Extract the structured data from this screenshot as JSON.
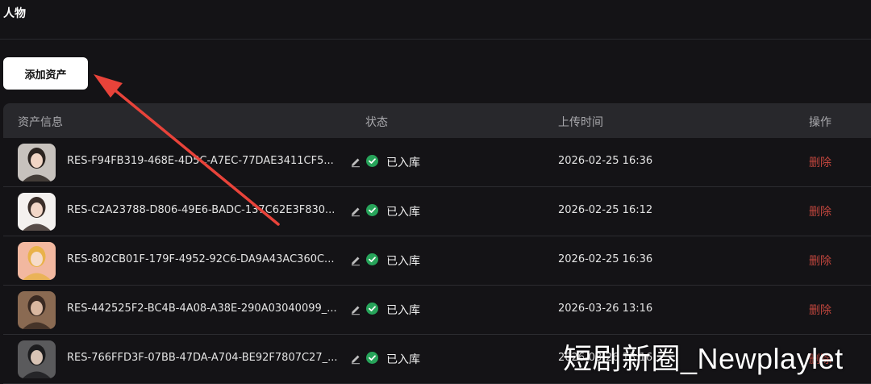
{
  "page": {
    "title": "人物",
    "add_button_label": "添加资产"
  },
  "table": {
    "headers": {
      "info": "资产信息",
      "status": "状态",
      "upload_time": "上传时间",
      "actions": "操作"
    },
    "rows": [
      {
        "id": "RES-F94FB319-468E-4D5C-A7EC-77DAE3411CF5...",
        "status": "已入库",
        "upload_time": "2026-02-25 16:36",
        "action": "删除",
        "thumb_colors": [
          "#c7c2bd",
          "#2b2420",
          "#f1d5c4"
        ]
      },
      {
        "id": "RES-C2A23788-D806-49E6-BADC-137C62E3F830...",
        "status": "已入库",
        "upload_time": "2026-02-25 16:12",
        "action": "删除",
        "thumb_colors": [
          "#f4f1ef",
          "#3b2f2a",
          "#f3d7c8"
        ]
      },
      {
        "id": "RES-802CB01F-179F-4952-92C6-DA9A43AC360C...",
        "status": "已入库",
        "upload_time": "2026-02-25 16:36",
        "action": "删除",
        "thumb_colors": [
          "#f2b8a0",
          "#e9b24a",
          "#f6dcc9"
        ]
      },
      {
        "id": "RES-442525F2-BC4B-4A08-A38E-290A03040099_...",
        "status": "已入库",
        "upload_time": "2026-03-26 13:16",
        "action": "删除",
        "thumb_colors": [
          "#8a6a52",
          "#3a2a22",
          "#d9b7a0"
        ]
      },
      {
        "id": "RES-766FFD3F-07BB-47DA-A704-BE92F7807C27_...",
        "status": "已入库",
        "upload_time": "2026-03-26 13:16",
        "action": "删除",
        "thumb_colors": [
          "#5a5a5c",
          "#1c1c1e",
          "#d8c3b4"
        ]
      }
    ]
  },
  "watermark": "短剧新圈_Newplaylet",
  "colors": {
    "background": "#141316",
    "header_bg": "#28282c",
    "delete": "#c0463d",
    "status_ok": "#27a45a",
    "arrow": "#e8433a"
  }
}
